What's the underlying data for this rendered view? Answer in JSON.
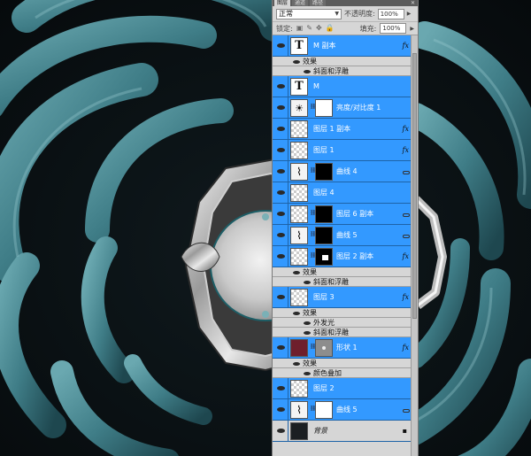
{
  "panel": {
    "tabs": [
      "图层",
      "通道",
      "路径"
    ],
    "close_label": "✕",
    "blend_mode": "正常",
    "opacity_label": "不透明度:",
    "opacity_value": "100%",
    "lock_label": "锁定:",
    "fill_label": "填充:",
    "fill_value": "100%"
  },
  "layers": [
    {
      "name": "M 副本",
      "kind": "text",
      "selected": true,
      "fx": "fx",
      "effects": [
        "效果",
        "斜面和浮雕"
      ]
    },
    {
      "name": "M",
      "kind": "text",
      "selected": true
    },
    {
      "name": "亮度/对比度 1",
      "kind": "brightness",
      "selected": true
    },
    {
      "name": "图层 1 副本",
      "kind": "pixel",
      "selected": true,
      "fx": "fx"
    },
    {
      "name": "图层 1",
      "kind": "pixel",
      "selected": true,
      "fx": "fx"
    },
    {
      "name": "曲线 4",
      "kind": "curves",
      "selected": true
    },
    {
      "name": "图层 4",
      "kind": "pixel",
      "selected": true
    },
    {
      "name": "图层 6 副本",
      "kind": "pixel-black",
      "selected": true
    },
    {
      "name": "曲线 5",
      "kind": "curves",
      "selected": true
    },
    {
      "name": "图层 2 副本",
      "kind": "pixel-mask",
      "selected": true,
      "fx": "fx",
      "effects": [
        "效果",
        "斜面和浮雕"
      ]
    },
    {
      "name": "图层 3",
      "kind": "pixel",
      "selected": true,
      "fx": "fx",
      "effects": [
        "效果",
        "外发光",
        "斜面和浮雕"
      ]
    },
    {
      "name": "形状 1",
      "kind": "shape",
      "selected": true,
      "fx": "fx",
      "effects": [
        "效果",
        "颜色叠加"
      ]
    },
    {
      "name": "图层 2",
      "kind": "pixel",
      "selected": true
    },
    {
      "name": "曲线 5",
      "kind": "curves2",
      "selected": true
    },
    {
      "name": "背景",
      "kind": "background",
      "selected": false
    }
  ],
  "colors": {
    "selection": "#3399ff",
    "panel_bg": "#d6d6d6",
    "artwork_teal": "#4a8c95",
    "shape_color": "#6e1f2c"
  },
  "icons": [
    "eye-icon",
    "link-icon",
    "fx-icon",
    "expand-arrow-icon",
    "lock-icon",
    "brightness-icon",
    "curves-icon"
  ]
}
